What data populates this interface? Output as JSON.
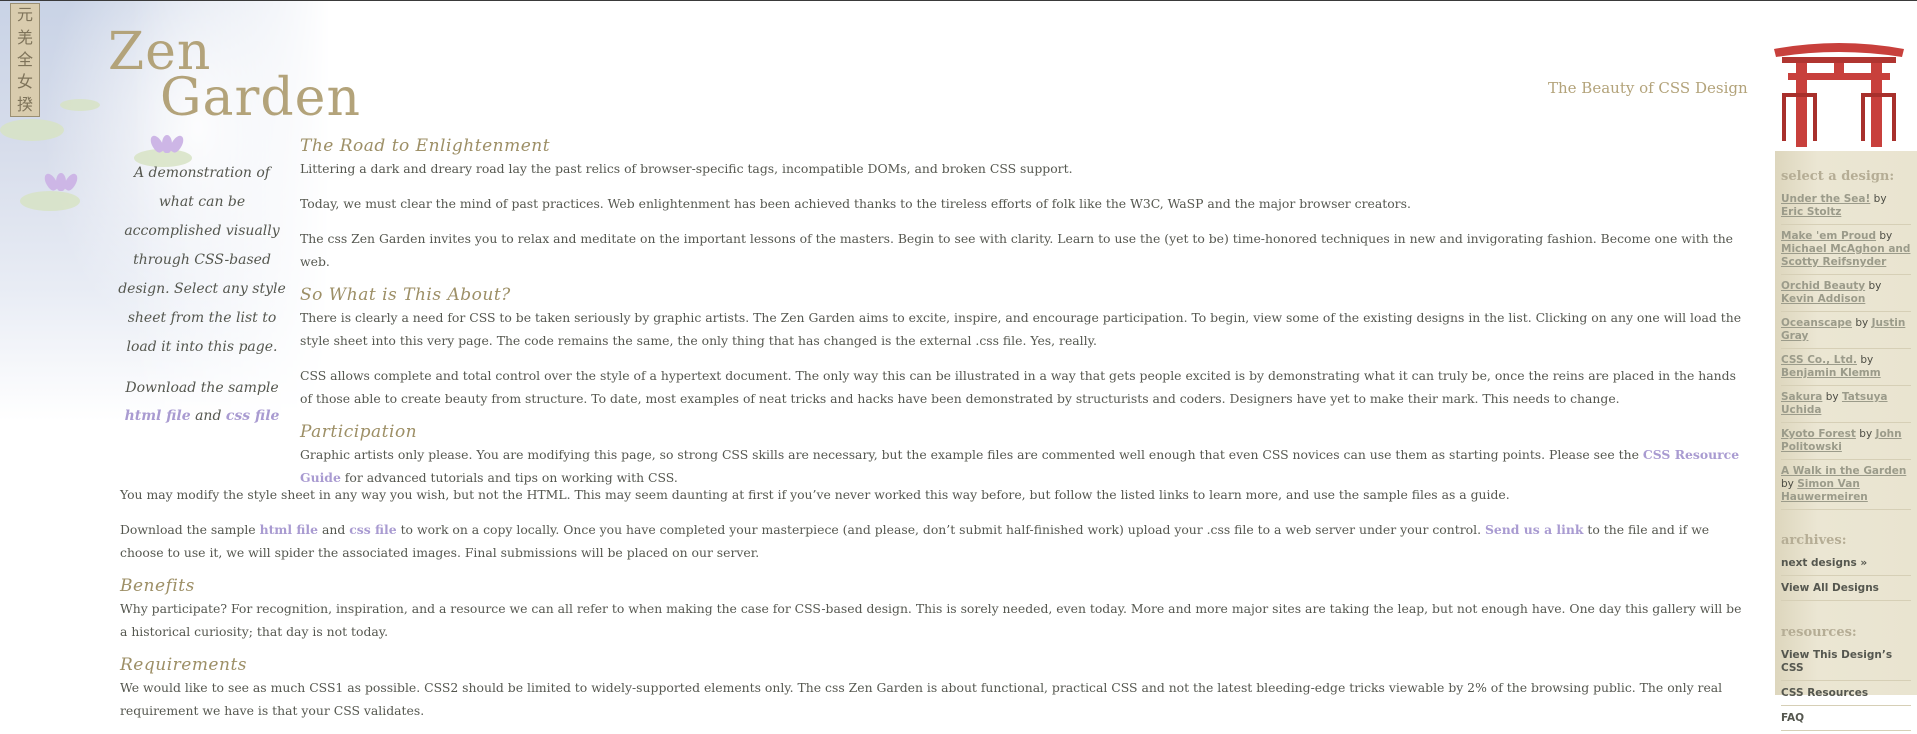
{
  "seal_glyphs": [
    "元",
    "羌",
    "全",
    "女",
    "揆"
  ],
  "logo": {
    "line1": "Zen",
    "line2": "Garden"
  },
  "tagline": "The Beauty of CSS Design",
  "intro": {
    "text": "A demonstration of what can be accomplished visually through CSS-based design. Select any style sheet from the list to load it into this page.",
    "download_prefix": "Download the sample",
    "html_link": "html file",
    "and": "and",
    "css_link": "css file"
  },
  "sections": {
    "road": {
      "title": "The Road to Enlightenment",
      "p1": "Littering a dark and dreary road lay the past relics of browser-specific tags, incompatible DOMs, and broken CSS support.",
      "p2": "Today, we must clear the mind of past practices. Web enlightenment has been achieved thanks to the tireless efforts of folk like the W3C, WaSP and the major browser creators.",
      "p3": "The css Zen Garden invites you to relax and meditate on the important lessons of the masters. Begin to see with clarity. Learn to use the (yet to be) time-honored techniques in new and invigorating fashion. Become one with the web."
    },
    "about": {
      "title": "So What is This About?",
      "p1": "There is clearly a need for CSS to be taken seriously by graphic artists. The Zen Garden aims to excite, inspire, and encourage participation. To begin, view some of the existing designs in the list. Clicking on any one will load the style sheet into this very page. The code remains the same, the only thing that has changed is the external .css file. Yes, really.",
      "p2": "CSS allows complete and total control over the style of a hypertext document. The only way this can be illustrated in a way that gets people excited is by demonstrating what it can truly be, once the reins are placed in the hands of those able to create beauty from structure. To date, most examples of neat tricks and hacks have been demonstrated by structurists and coders. Designers have yet to make their mark. This needs to change."
    },
    "participation": {
      "title": "Participation",
      "p1_before": "Graphic artists only please. You are modifying this page, so strong CSS skills are necessary, but the example files are commented well enough that even CSS novices can use them as starting points. Please see the ",
      "p1_link": "CSS Resource Guide",
      "p1_after": " for advanced tutorials and tips on working with CSS.",
      "p2": "You may modify the style sheet in any way you wish, but not the HTML. This may seem daunting at first if you’ve never worked this way before, but follow the listed links to learn more, and use the sample files as a guide.",
      "p3_a": "Download the sample ",
      "p3_html": "html file",
      "p3_b": " and ",
      "p3_css": "css file",
      "p3_c": " to work on a copy locally. Once you have completed your masterpiece (and please, don’t submit half-finished work) upload your .css file to a web server under your control. ",
      "p3_send": "Send us a link",
      "p3_d": " to the file and if we choose to use it, we will spider the associated images. Final submissions will be placed on our server."
    },
    "benefits": {
      "title": "Benefits",
      "p1": "Why participate? For recognition, inspiration, and a resource we can all refer to when making the case for CSS-based design. This is sorely needed, even today. More and more major sites are taking the leap, but not enough have. One day this gallery will be a historical curiosity; that day is not today."
    },
    "requirements": {
      "title": "Requirements",
      "p1": "We would like to see as much CSS1 as possible. CSS2 should be limited to widely-supported elements only. The css Zen Garden is about functional, practical CSS and not the latest bleeding-edge tricks viewable by 2% of the browsing public. The only real requirement we have is that your CSS validates."
    }
  },
  "sidebar": {
    "select_heading": "select a design:",
    "by": "by",
    "designs": [
      {
        "name": "Under the Sea!",
        "author": "Eric Stoltz"
      },
      {
        "name": "Make 'em Proud",
        "author": "Michael McAghon and Scotty Reifsnyder"
      },
      {
        "name": "Orchid Beauty",
        "author": "Kevin Addison"
      },
      {
        "name": "Oceanscape",
        "author": "Justin Gray"
      },
      {
        "name": "CSS Co., Ltd.",
        "author": "Benjamin Klemm"
      },
      {
        "name": "Sakura",
        "author": "Tatsuya Uchida"
      },
      {
        "name": "Kyoto Forest",
        "author": "John Politowski"
      },
      {
        "name": "A Walk in the Garden",
        "author": "Simon Van Hauwermeiren"
      }
    ],
    "archives_heading": "archives:",
    "archives": [
      "next designs »",
      "View All Designs"
    ],
    "resources_heading": "resources:",
    "resources": [
      "View This Design’s CSS",
      "CSS Resources",
      "FAQ"
    ]
  },
  "colors": {
    "link": "#a99bd1",
    "heading": "#9d8f66",
    "text": "#55574f",
    "gate": "#c8403c"
  }
}
